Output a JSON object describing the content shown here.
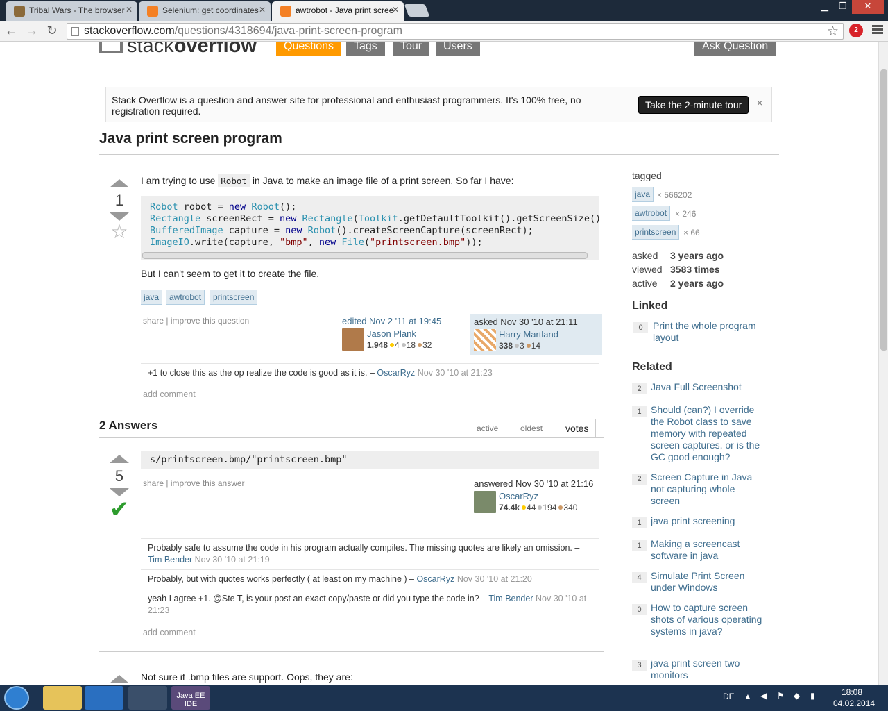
{
  "browser": {
    "tabs": [
      {
        "title": "Tribal Wars - The browser",
        "fav_color": "#8b6a3a"
      },
      {
        "title": "Selenium: get coordinates",
        "fav_color": "#f48024"
      },
      {
        "title": "awtrobot - Java print scree",
        "fav_color": "#f48024"
      }
    ],
    "url_host": "stackoverflow.com",
    "url_path": "/questions/4318694/java-print-screen-program",
    "ext_badge": "2"
  },
  "site": {
    "logo_light": "stack",
    "logo_bold": "overflow",
    "nav": [
      "Questions",
      "Tags",
      "Tour",
      "Users"
    ],
    "ask": "Ask Question"
  },
  "banner": {
    "text": "Stack Overflow is a question and answer site for professional and enthusiast programmers. It's 100% free, no registration required.",
    "button": "Take the 2-minute tour",
    "close": "×"
  },
  "question": {
    "title": "Java print screen program",
    "votes": "1",
    "intro_a": "I am trying to use",
    "intro_code": "Robot",
    "intro_b": "in Java to make an image file of a print screen. So far I have:",
    "after": "But I can't seem to get it to create the file.",
    "tags": [
      "java",
      "awtrobot",
      "printscreen"
    ],
    "share": "share",
    "improve": "improve this question",
    "edited": "edited Nov 2 '11 at 19:45",
    "editor": {
      "name": "Jason Plank",
      "rep": "1,948",
      "gold": "4",
      "silver": "18",
      "bronze": "32"
    },
    "asked": "asked Nov 30 '10 at 21:11",
    "asker": {
      "name": "Harry Martland",
      "rep": "338",
      "silver": "3",
      "bronze": "14"
    },
    "comment": {
      "text": "+1 to close this as the op realize the code is good as it is. –",
      "user": "OscarRyz",
      "date": "Nov 30 '10 at 21:23"
    },
    "add_comment": "add comment"
  },
  "answers_header": "2 Answers",
  "sort_tabs": [
    "active",
    "oldest",
    "votes"
  ],
  "answer": {
    "votes": "5",
    "code": "s/printscreen.bmp/\"printscreen.bmp\"",
    "share": "share",
    "improve": "improve this answer",
    "answered": "answered Nov 30 '10 at 21:16",
    "user": {
      "name": "OscarRyz",
      "rep": "74.4k",
      "gold": "44",
      "silver": "194",
      "bronze": "340"
    },
    "comments": [
      {
        "text": "Probably safe to assume the code in his program actually compiles. The missing quotes are likely an omission. –",
        "user": "Tim Bender",
        "date": "Nov 30 '10 at 21:19"
      },
      {
        "text": "Probably, but with quotes works perfectly ( at least on my machine ) –",
        "user": "OscarRyz",
        "date": "Nov 30 '10 at 21:20"
      },
      {
        "text": "yeah I agree +1. @Ste T, is your post an exact copy/paste or did you type the code in? –",
        "user": "Tim Bender",
        "date": "Nov 30 '10 at 21:23"
      }
    ],
    "add_comment": "add comment"
  },
  "answer2_text": "Not sure if .bmp files are support. Oops, they are:",
  "sidebar": {
    "tagged": "tagged",
    "tags": [
      {
        "name": "java",
        "count": "× 566202"
      },
      {
        "name": "awtrobot",
        "count": "× 246"
      },
      {
        "name": "printscreen",
        "count": "× 66"
      }
    ],
    "stats": [
      {
        "label": "asked",
        "value": "3 years ago"
      },
      {
        "label": "viewed",
        "value": "3583 times"
      },
      {
        "label": "active",
        "value": "2 years ago"
      }
    ],
    "linked_title": "Linked",
    "linked": [
      {
        "count": "0",
        "title": "Print the whole program layout"
      }
    ],
    "related_title": "Related",
    "related": [
      {
        "count": "2",
        "title": "Java Full Screenshot"
      },
      {
        "count": "1",
        "title": "Should (can?) I override the Robot class to save memory with repeated screen captures, or is the GC good enough?"
      },
      {
        "count": "2",
        "title": "Screen Capture in Java not capturing whole screen"
      },
      {
        "count": "1",
        "title": "java print screening"
      },
      {
        "count": "1",
        "title": "Making a screencast software in java"
      },
      {
        "count": "4",
        "title": "Simulate Print Screen under Windows"
      },
      {
        "count": "0",
        "title": "How to capture screen shots of various operating systems in java?"
      },
      {
        "count": "3",
        "title": "java print screen two monitors"
      }
    ]
  },
  "taskbar": {
    "lang": "DE",
    "time": "18:08",
    "date": "04.02.2014",
    "java_label": "Java EE IDE"
  }
}
